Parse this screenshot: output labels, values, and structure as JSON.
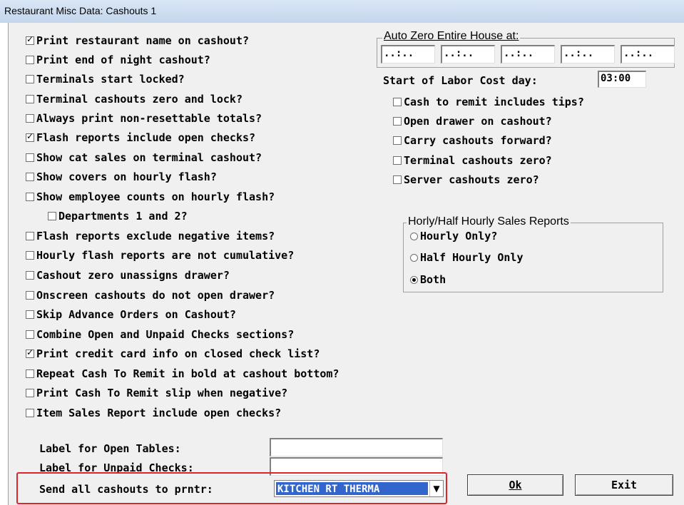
{
  "window": {
    "title": "Restaurant Misc Data: Cashouts 1"
  },
  "left_checkboxes": [
    {
      "label": "Print restaurant name on cashout?",
      "checked": true
    },
    {
      "label": "Print end of night cashout?",
      "checked": false
    },
    {
      "label": "Terminals start locked?",
      "checked": false
    },
    {
      "label": "Terminal cashouts zero and lock?",
      "checked": false
    },
    {
      "label": "Always print non-resettable totals?",
      "checked": false
    },
    {
      "label": "Flash reports include open checks?",
      "checked": true
    },
    {
      "label": "Show cat sales on terminal cashout?",
      "checked": false
    },
    {
      "label": "Show covers on hourly flash?",
      "checked": false
    },
    {
      "label": "Show employee counts on hourly flash?",
      "checked": false
    },
    {
      "label": "Departments 1 and 2?",
      "checked": false
    },
    {
      "label": "Flash reports exclude negative items?",
      "checked": false
    },
    {
      "label": "Hourly flash reports are not cumulative?",
      "checked": false
    },
    {
      "label": "Cashout zero unassigns drawer?",
      "checked": false
    },
    {
      "label": "Onscreen cashouts do not open drawer?",
      "checked": false
    },
    {
      "label": "Skip Advance Orders on Cashout?",
      "checked": false
    },
    {
      "label": "Combine Open and Unpaid Checks sections?",
      "checked": false
    },
    {
      "label": "Print credit card info on closed check list?",
      "checked": true
    },
    {
      "label": "Repeat Cash To Remit in bold at cashout bottom?",
      "checked": false
    },
    {
      "label": "Print Cash To Remit slip when negative?",
      "checked": false
    },
    {
      "label": "Item Sales Report include open checks?",
      "checked": false
    }
  ],
  "auto_zero": {
    "title": "Auto Zero Entire House at:",
    "times": [
      "..:..",
      "..:..",
      "..:..",
      "..:..",
      "..:.."
    ]
  },
  "labor": {
    "label": "Start of Labor Cost day:",
    "value": "03:00"
  },
  "right_checkboxes": [
    {
      "label": "Cash to remit includes tips?",
      "checked": false
    },
    {
      "label": "Open drawer on cashout?",
      "checked": false
    },
    {
      "label": "Carry cashouts forward?",
      "checked": false
    },
    {
      "label": "Terminal cashouts zero?",
      "checked": false
    },
    {
      "label": "Server cashouts zero?",
      "checked": false
    }
  ],
  "sales_reports": {
    "title": "Horly/Half Hourly Sales Reports",
    "options": [
      {
        "label": "Hourly Only?",
        "selected": false
      },
      {
        "label": "Half Hourly Only",
        "selected": false
      },
      {
        "label": "Both",
        "selected": true
      }
    ]
  },
  "open_tables": {
    "label": "Label for Open Tables:",
    "value": ""
  },
  "unpaid_checks": {
    "label": "Label for Unpaid Checks:",
    "value": ""
  },
  "send_cashouts": {
    "label": "Send all cashouts to prntr:",
    "value": "KITCHEN RT THERMA"
  },
  "buttons": {
    "ok": "Ok",
    "exit": "Exit"
  },
  "colors": {
    "highlight": "#e0242c",
    "selection": "#3366cc"
  }
}
